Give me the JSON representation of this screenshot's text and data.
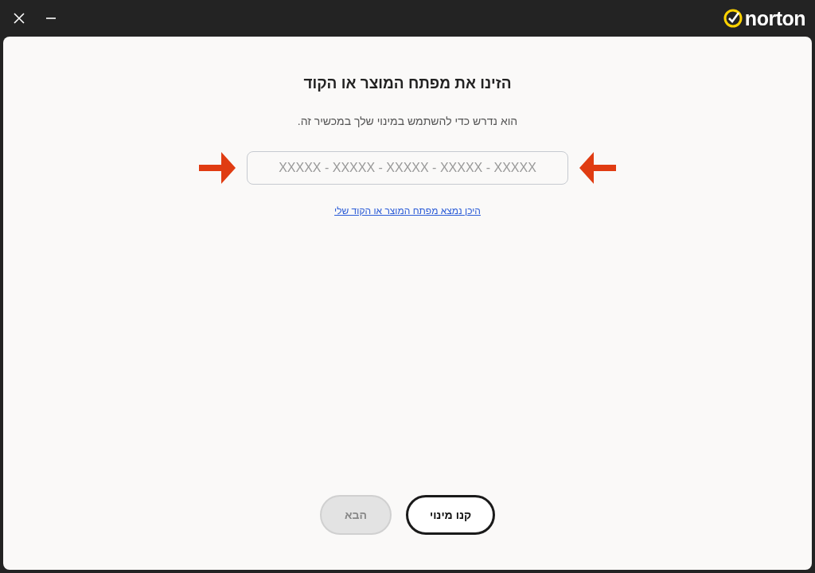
{
  "window": {
    "logo": "norton"
  },
  "title": "הזינו את מפתח המוצר או הקוד",
  "subtitle": "הוא נדרש כדי להשתמש במינוי שלך במכשיר זה.",
  "key_field": {
    "placeholder": "XXXXX - XXXXX - XXXXX - XXXXX - XXXXX"
  },
  "help_link": "היכן נמצא מפתח המוצר או הקוד שלי",
  "buttons": [
    {
      "label": "קנו מינוי",
      "disabled": false
    },
    {
      "label": "הבא",
      "disabled": true
    }
  ]
}
